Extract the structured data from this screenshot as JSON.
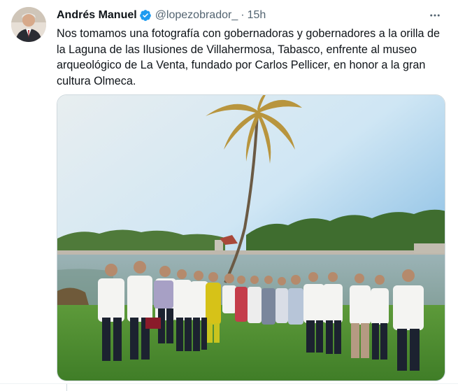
{
  "author": {
    "display_name": "Andrés Manuel",
    "handle": "@lopezobrador_",
    "separator": "·",
    "time": "15h",
    "verified": true,
    "verified_color": "#1d9bf0"
  },
  "tweet": {
    "text": "Nos tomamos una fotografía con gobernadoras y gobernadores a la orilla de la Laguna de las Ilusiones de Villahermosa, Tabasco, enfrente al museo arqueológico de La Venta, fundado por Carlos Pellicer, en honor a la gran cultura Olmeca."
  },
  "more_icon": "more-dots-icon",
  "colors": {
    "text": "#0f1419",
    "secondary": "#536471",
    "border": "#cfd9de"
  }
}
